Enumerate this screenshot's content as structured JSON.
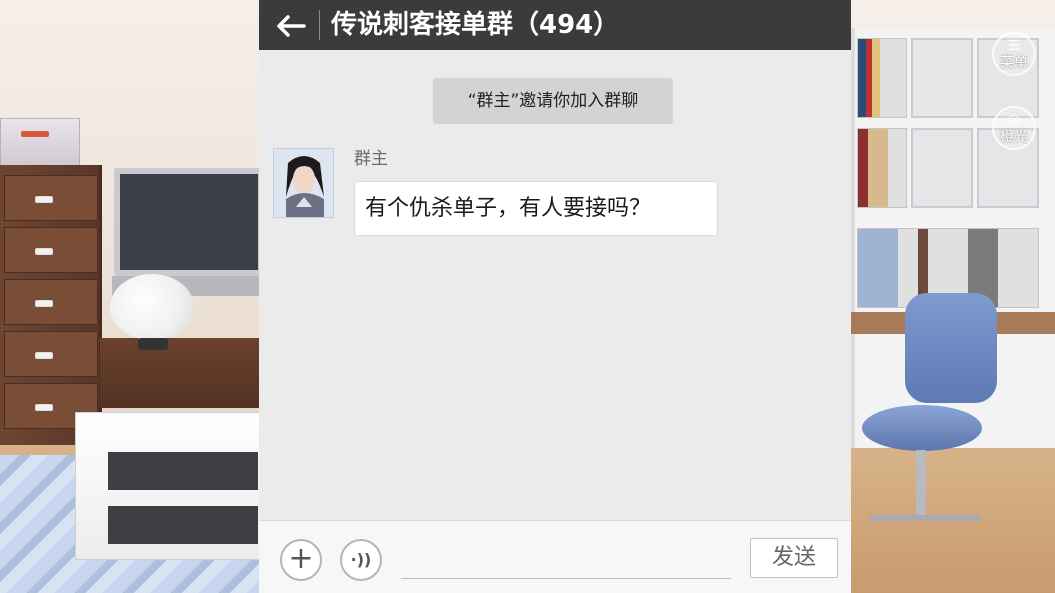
{
  "header": {
    "back_icon": "left-arrow-icon",
    "title": "传说刺客接单群（494）"
  },
  "messages": {
    "system_notice": "“群主”邀请你加入群聊",
    "items": [
      {
        "sender": "群主",
        "text": "有个仇杀单子，有人要接吗？"
      }
    ]
  },
  "input_bar": {
    "plus_icon": "plus-icon",
    "voice_icon": "voice-icon",
    "message_value": "",
    "send_label": "发送"
  },
  "game_menu": {
    "menu_label": "菜单",
    "menu_icon": "list-icon",
    "light_label": "橙光",
    "light_icon": "orange-light-logo-icon"
  },
  "colors": {
    "header_bg": "#3b3b3b",
    "chat_bg": "#ebebeb",
    "system_note_bg": "#d3d3d3",
    "bubble_bg": "#ffffff"
  }
}
